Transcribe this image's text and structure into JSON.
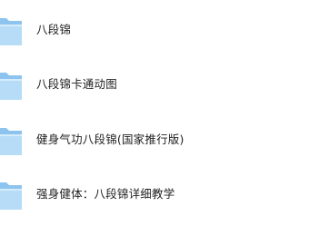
{
  "folders": [
    {
      "name": "八段锦",
      "icon": "folder-icon"
    },
    {
      "name": "八段锦卡通动图",
      "icon": "folder-icon"
    },
    {
      "name": "健身气功八段锦(国家推行版)",
      "icon": "folder-icon"
    },
    {
      "name": "强身健体：八段锦详细教学",
      "icon": "folder-icon"
    }
  ],
  "colors": {
    "folder_back": "#8cc3ef",
    "folder_front": "#b6dcf8",
    "text": "#1f1f1f"
  }
}
